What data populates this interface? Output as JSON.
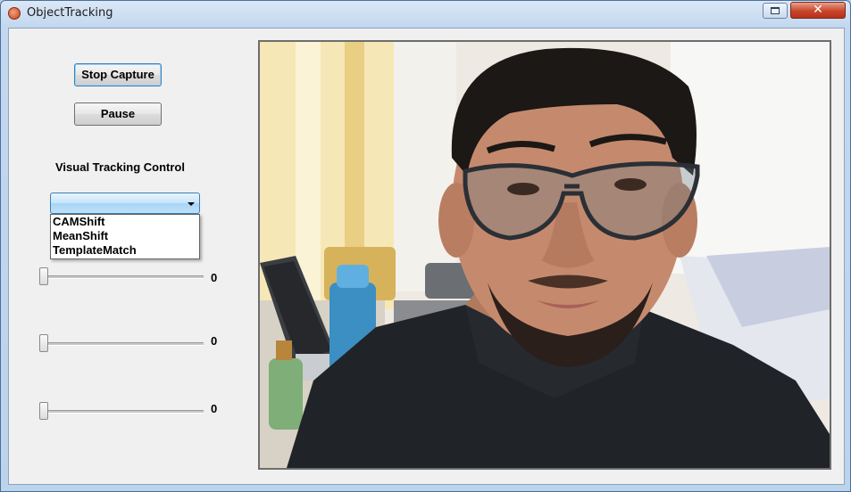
{
  "window": {
    "title": "ObjectTracking",
    "close_glyph": "✕"
  },
  "controls": {
    "stop_capture_label": "Stop Capture",
    "pause_label": "Pause",
    "section_label": "Visual Tracking Control",
    "tracker_select": {
      "selected": "",
      "options": [
        "CAMShift",
        "MeanShift",
        "TemplateMatch"
      ]
    },
    "sliders": [
      {
        "value": "0",
        "level": 0
      },
      {
        "value": "0",
        "level": 0
      },
      {
        "value": "0",
        "level": 0
      }
    ]
  },
  "icons": {
    "app": "app-icon",
    "restore": "restore-icon",
    "close": "close-icon",
    "dropdown": "chevron-down-icon"
  },
  "colors": {
    "title_bar": "#c3d8ef",
    "close_button": "#c8462b",
    "combo_highlight": "#a7d5f6",
    "client_bg": "#f0f0f0"
  }
}
